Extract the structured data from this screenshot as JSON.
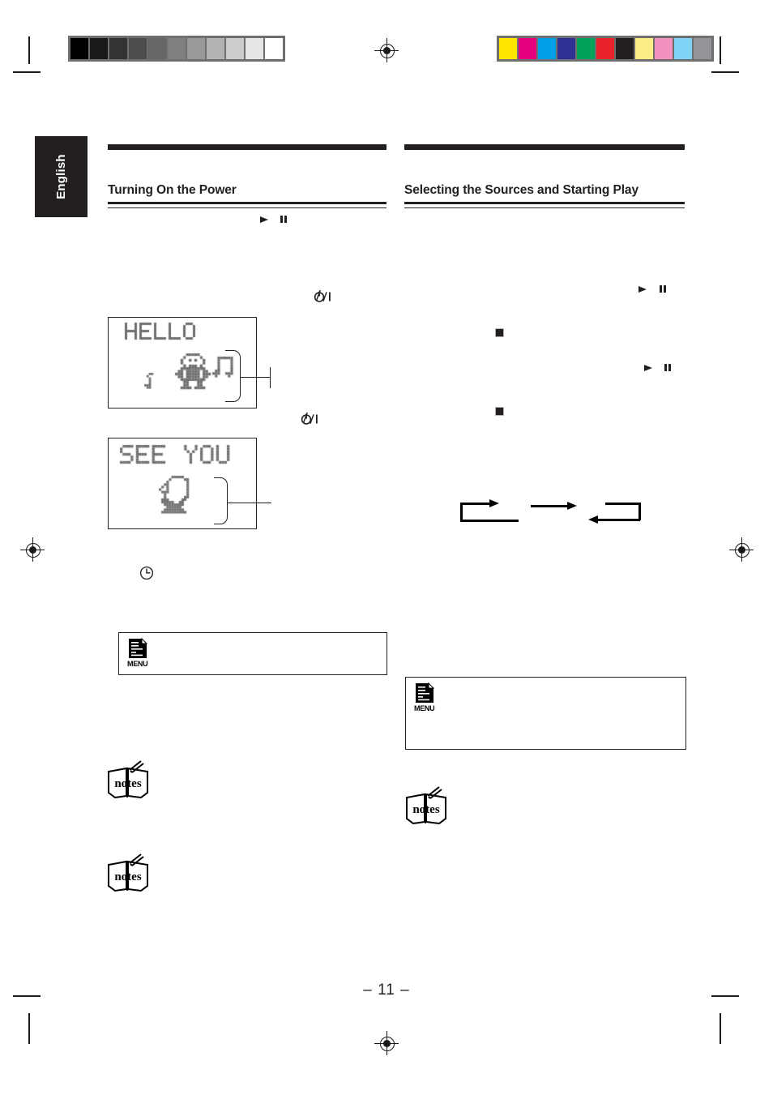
{
  "page": {
    "number_label": "– 11 –",
    "language_tab": "English"
  },
  "prepress": {
    "grayscale_bar": {
      "name": "grayscale-calibration-bar",
      "swatches": [
        "#000000",
        "#1a1a1a",
        "#333333",
        "#4d4d4d",
        "#666666",
        "#808080",
        "#999999",
        "#b3b3b3",
        "#cccccc",
        "#e6e6e6",
        "#ffffff"
      ]
    },
    "color_bar": {
      "name": "color-calibration-bar",
      "swatches": [
        "#ffe600",
        "#e5007e",
        "#00a0e9",
        "#2e3192",
        "#00a25b",
        "#e8232a",
        "#231f20",
        "#fbec86",
        "#f491c0",
        "#7fd4f5",
        "#939598"
      ]
    },
    "registration_marks": 4
  },
  "columns": {
    "left": {
      "heading": "Turning On the Power",
      "symbols": {
        "play": "▶",
        "pause": "❙❙",
        "standby_on": "⏻/❙",
        "timer_clock": "clock-icon"
      },
      "displays": [
        {
          "id": "hello-display",
          "text": "HELLO",
          "figure": "gorilla-with-music-note"
        },
        {
          "id": "see-you-display",
          "text": "SEE YOU",
          "figure": "gorilla-waving-goodbye"
        }
      ],
      "menu_box": {
        "label": "MENU",
        "icon": "menu-document-icon"
      },
      "notes_boxes": [
        {
          "label": "notes",
          "icon": "notes-icon"
        },
        {
          "label": "notes",
          "icon": "notes-icon"
        }
      ]
    },
    "right": {
      "heading": "Selecting the Sources and Starting Play",
      "symbols": {
        "play": "▶",
        "pause": "❙❙",
        "stop": "■"
      },
      "source_flow": {
        "type": "cycle-diagram",
        "arrows": [
          "right",
          "right",
          "left"
        ]
      },
      "menu_box": {
        "label": "MENU",
        "icon": "menu-document-icon"
      },
      "notes_boxes": [
        {
          "label": "notes",
          "icon": "notes-icon"
        }
      ]
    }
  },
  "colors": {
    "ink": "#231f20",
    "lcd_pixel": "#6f6f6f",
    "paper": "#ffffff"
  }
}
